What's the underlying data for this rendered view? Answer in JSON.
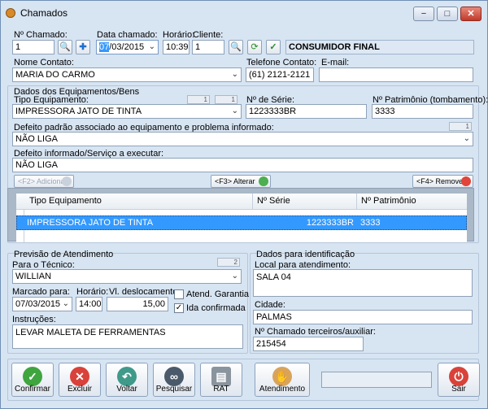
{
  "window": {
    "title": "Chamados",
    "min": "−",
    "max": "□",
    "close": "✕"
  },
  "header": {
    "num_chamado_label": "Nº Chamado:",
    "num_chamado": "1",
    "data_label": "Data chamado:",
    "data_day": "07",
    "data_rest": "/03/2015",
    "hora_label": "Horário:",
    "hora": "10:39",
    "cliente_label": "Cliente:",
    "cliente_id": "1",
    "cliente_nome": "CONSUMIDOR FINAL",
    "contato_label": "Nome Contato:",
    "contato": "MARIA DO CARMO",
    "telefone_label": "Telefone Contato:",
    "telefone": "(61) 2121-2121",
    "email_label": "E-mail:",
    "email": ""
  },
  "equip": {
    "group_title": "Dados dos Equipamentos/Bens",
    "tipo_label": "Tipo Equipamento:",
    "tipo": "IMPRESSORA JATO DE TINTA",
    "tipo_code1": "1",
    "tipo_code2": "1",
    "serie_label": "Nº de Série:",
    "serie": "1223333BR",
    "patrimonio_label": "Nº Patrimônio (tombamento):",
    "patrimonio": "3333",
    "defeito_padrao_label": "Defeito padrão associado ao equipamento e problema informado:",
    "defeito_padrao_code": "1",
    "defeito_padrao": "NÃO LIGA",
    "defeito_inf_label": "Defeito informado/Serviço a executar:",
    "defeito_inf": "NÃO LIGA",
    "btn_add": "<F2> Adicionar",
    "btn_alt": "<F3> Alterar",
    "btn_rem": "<F4> Remover"
  },
  "table": {
    "headers": [
      "Tipo Equipamento",
      "Nº Série",
      "Nº Patrimônio"
    ],
    "rows": [
      [
        "IMPRESSORA JATO DE TINTA",
        "1223333BR",
        "3333"
      ]
    ]
  },
  "previsao": {
    "group_title": "Previsão de Atendimento",
    "tecnico_label": "Para o Técnico:",
    "tecnico": "WILLIAN",
    "tecnico_code": "2",
    "marcado_label": "Marcado para:",
    "marcado": "07/03/2015",
    "hora_label": "Horário:",
    "hora": "14:00",
    "desloc_label": "Vl. deslocamento:",
    "desloc": "15,00",
    "garantia_label": "Atend. Garantia",
    "garantia_checked": false,
    "ida_label": "Ida confirmada",
    "ida_checked": true,
    "instr_label": "Instruções:",
    "instr": "LEVAR MALETA DE FERRAMENTAS"
  },
  "ident": {
    "group_title": "Dados para identificação",
    "local_label": "Local para atendimento:",
    "local": "SALA 04",
    "cidade_label": "Cidade:",
    "cidade": "PALMAS",
    "terc_label": "Nº Chamado terceiros/auxiliar:",
    "terc": "215454"
  },
  "toolbar": {
    "confirmar": "Confirmar",
    "excluir": "Excluir",
    "voltar": "Voltar",
    "pesquisar": "Pesquisar",
    "rat": "RAT",
    "atendimento": "Atendimento",
    "sair": "Sair"
  },
  "colors": {
    "accent": "#3399ff",
    "window_bg": "#d7e4f2"
  }
}
